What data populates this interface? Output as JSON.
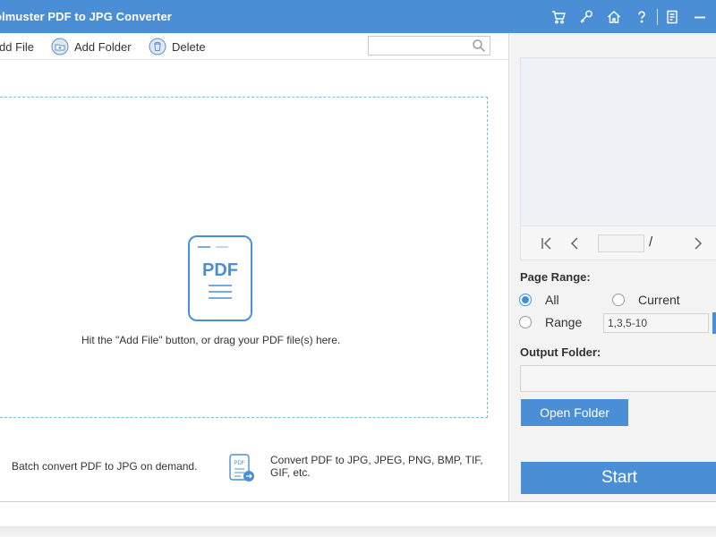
{
  "window": {
    "title": "olmuster PDF to JPG Converter",
    "accent_color": "#4a8fd6"
  },
  "titlebar_buttons": [
    {
      "name": "cart-icon"
    },
    {
      "name": "key-icon"
    },
    {
      "name": "home-icon"
    },
    {
      "name": "help-icon"
    },
    {
      "name": "feedback-icon"
    },
    {
      "name": "minimize-icon"
    }
  ],
  "toolbar": {
    "add_file_label": "dd File",
    "add_folder_label": "Add Folder",
    "delete_label": "Delete",
    "search_placeholder": "",
    "search_value": ""
  },
  "main": {
    "drop_icon_text": "PDF",
    "drop_hint": "Hit the \"Add File\" button, or drag your PDF file(s) here.",
    "batch_text": "Batch convert PDF to JPG on demand.",
    "formats_icon_text": "PDF",
    "formats_text": "Convert PDF to JPG, JPEG, PNG, BMP, TIF, GIF, etc."
  },
  "preview": {
    "page_value": "",
    "page_separator": "/"
  },
  "page_range": {
    "label": "Page Range:",
    "options": [
      {
        "label": "All",
        "selected": true
      },
      {
        "label": "Current",
        "selected": false
      },
      {
        "label": "Range",
        "selected": false
      }
    ],
    "range_value": "1,3,5-10"
  },
  "output": {
    "label": "Output Folder:",
    "path_value": "",
    "open_folder_label": "Open Folder"
  },
  "start_label": "Start"
}
